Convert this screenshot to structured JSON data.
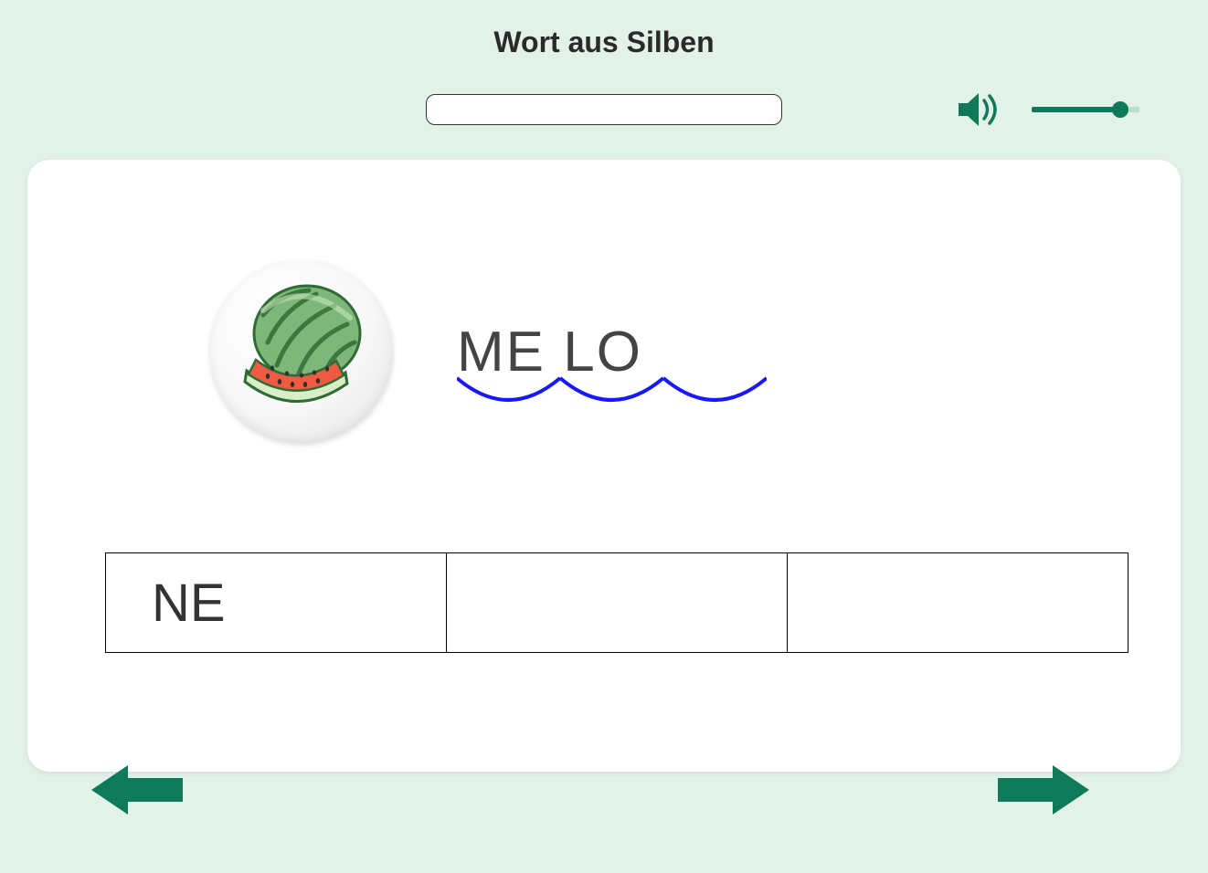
{
  "title": "Wort aus Silben",
  "input": {
    "value": ""
  },
  "colors": {
    "accent": "#0f7a5a",
    "arc": "#1818ff"
  },
  "word": {
    "image_name": "watermelon-icon",
    "placed_syllables": [
      "ME",
      "LO"
    ],
    "arc_count": 3
  },
  "syllable_options": [
    "NE",
    "",
    ""
  ],
  "volume": {
    "value": 82,
    "max": 100
  }
}
